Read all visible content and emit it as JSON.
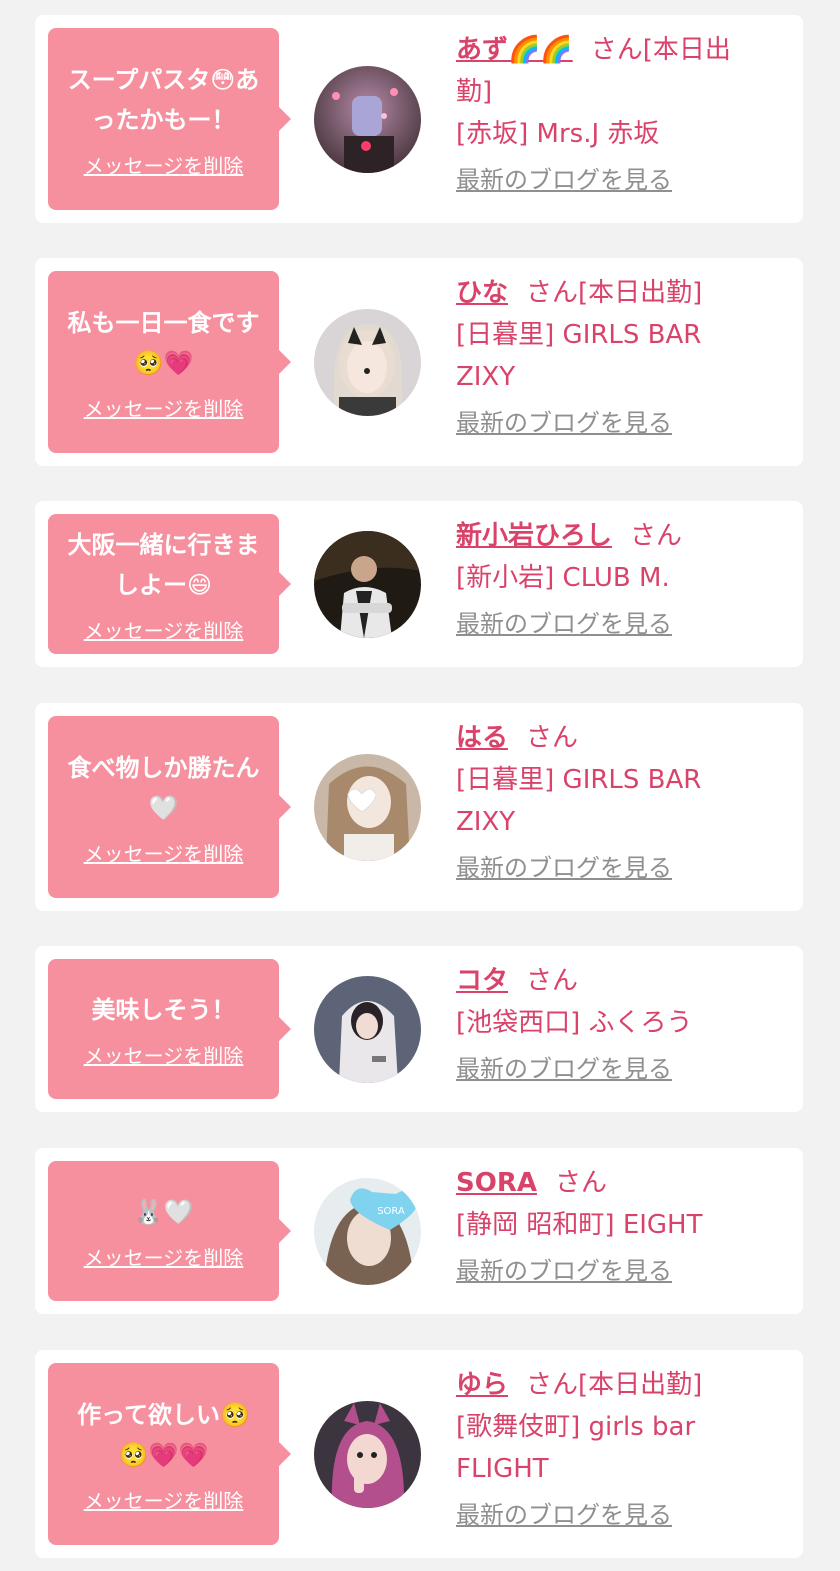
{
  "cards": [
    {
      "message": [
        "スープパスタ😳あ",
        "ったかもー！"
      ],
      "delete_label": "メッセージを削除",
      "name": "あず🌈🌈",
      "name_suffix": "さん[本日出",
      "name_suffix_2": "勤]",
      "shop": "[赤坂] Mrs.J 赤坂",
      "shop_2": "",
      "blog_label": "最新のブログを見る"
    },
    {
      "message": [
        "私も一日一食です",
        "🥺💗"
      ],
      "delete_label": "メッセージを削除",
      "name": "ひな",
      "name_suffix": "さん[本日出勤]",
      "name_suffix_2": "",
      "shop": "[日暮里] GIRLS BAR",
      "shop_2": "ZIXY",
      "blog_label": "最新のブログを見る"
    },
    {
      "message": [
        "大阪一緒に行きま",
        "しよー😄"
      ],
      "delete_label": "メッセージを削除",
      "name": "新小岩ひろし",
      "name_suffix": "さん",
      "name_suffix_2": "",
      "shop": "[新小岩] CLUB M.",
      "shop_2": "",
      "blog_label": "最新のブログを見る"
    },
    {
      "message": [
        "食べ物しか勝たん",
        "🤍"
      ],
      "delete_label": "メッセージを削除",
      "name": "はる",
      "name_suffix": "さん",
      "name_suffix_2": "",
      "shop": "[日暮里] GIRLS BAR",
      "shop_2": "ZIXY",
      "blog_label": "最新のブログを見る"
    },
    {
      "message": [
        "美味しそう！"
      ],
      "delete_label": "メッセージを削除",
      "name": "コタ",
      "name_suffix": "さん",
      "name_suffix_2": "",
      "shop": "[池袋西口] ふくろう",
      "shop_2": "",
      "blog_label": "最新のブログを見る"
    },
    {
      "message": [
        "🐰🤍"
      ],
      "delete_label": "メッセージを削除",
      "name": "SORA",
      "name_suffix": "さん",
      "name_suffix_2": "",
      "shop": "[静岡 昭和町] EIGHT",
      "shop_2": "",
      "blog_label": "最新のブログを見る"
    },
    {
      "message": [
        "作って欲しい🥺",
        "🥺💗💗"
      ],
      "delete_label": "メッセージを削除",
      "name": "ゆら",
      "name_suffix": "さん[本日出勤]",
      "name_suffix_2": "",
      "shop": "[歌舞伎町] girls bar",
      "shop_2": "FLIGHT",
      "blog_label": "最新のブログを見る"
    }
  ],
  "colors": {
    "background": "#f2f2f2",
    "bubble": "#f7909e",
    "accent_text": "#d9436a",
    "link_gray": "#8f8f8f"
  },
  "avatar_badges": {
    "sora_tag": "SORA"
  }
}
